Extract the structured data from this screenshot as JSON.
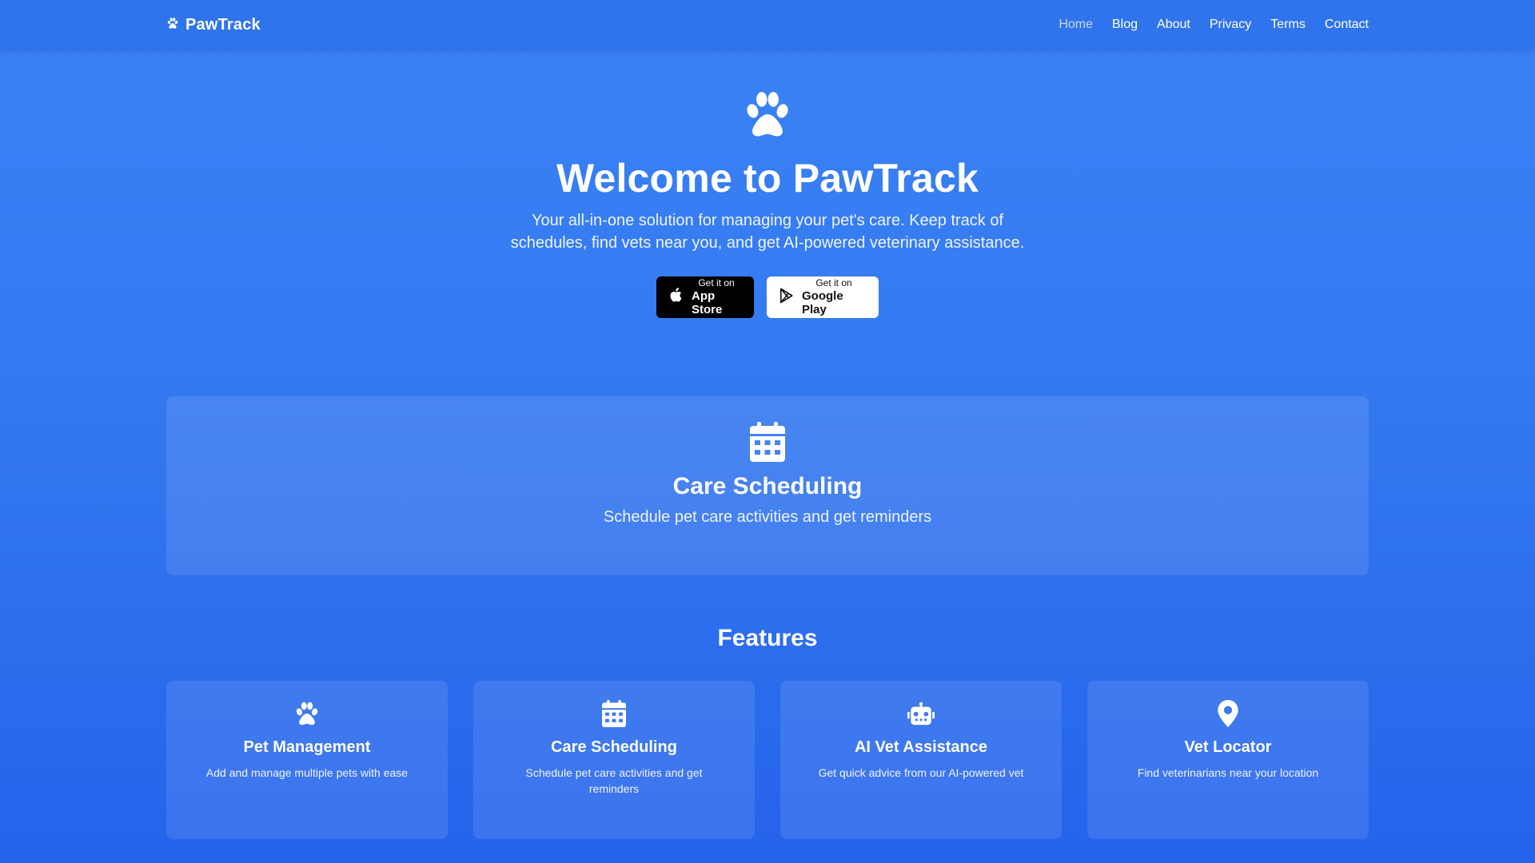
{
  "header": {
    "brand": "PawTrack",
    "brand_icon": "paw-icon",
    "nav": [
      {
        "label": "Home",
        "active": true
      },
      {
        "label": "Blog",
        "active": false
      },
      {
        "label": "About",
        "active": false
      },
      {
        "label": "Privacy",
        "active": false
      },
      {
        "label": "Terms",
        "active": false
      },
      {
        "label": "Contact",
        "active": false
      }
    ]
  },
  "hero": {
    "icon": "paw-icon",
    "title": "Welcome to PawTrack",
    "subtitle": "Your all-in-one solution for managing your pet's care. Keep track of schedules, find vets near you, and get AI-powered veterinary assistance.",
    "app_store": {
      "small": "Get it on",
      "big": "App Store",
      "icon": "apple-icon"
    },
    "google_play": {
      "small": "Get it on",
      "big": "Google Play",
      "icon": "google-play-icon"
    }
  },
  "featured": {
    "icon": "calendar-icon",
    "title": "Care Scheduling",
    "description": "Schedule pet care activities and get reminders"
  },
  "features": {
    "title": "Features",
    "cards": [
      {
        "icon": "paw-icon",
        "title": "Pet Management",
        "description": "Add and manage multiple pets with ease"
      },
      {
        "icon": "calendar-icon",
        "title": "Care Scheduling",
        "description": "Schedule pet care activities and get reminders"
      },
      {
        "icon": "robot-icon",
        "title": "AI Vet Assistance",
        "description": "Get quick advice from our AI-powered vet"
      },
      {
        "icon": "map-pin-icon",
        "title": "Vet Locator",
        "description": "Find veterinarians near your location"
      }
    ]
  },
  "colors": {
    "background": "#3b82f6",
    "header": "#2f74ec",
    "app_store_button": "#000000",
    "google_play_button": "#ffffff"
  }
}
